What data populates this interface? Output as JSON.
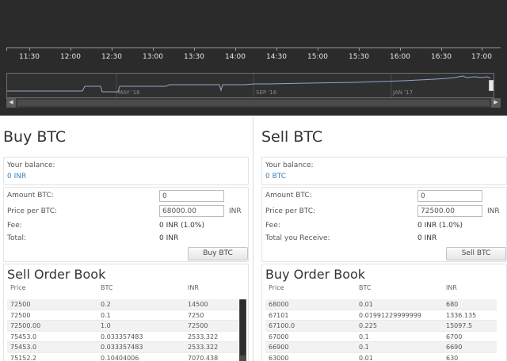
{
  "chart": {
    "time_labels": [
      "11:30",
      "12:00",
      "12:30",
      "13:00",
      "13:30",
      "14:00",
      "14:30",
      "15:00",
      "15:30",
      "16:00",
      "16:30",
      "17:00"
    ],
    "navigator_labels": [
      "MAY '16",
      "SEP '16",
      "JAN '17"
    ],
    "colors": {
      "background": "#2b2b2b",
      "line": "#8fa7c8"
    }
  },
  "buy": {
    "title": "Buy BTC",
    "balance_label": "Your balance:",
    "balance_value": "0 INR",
    "amount_label": "Amount BTC:",
    "amount_value": "0",
    "price_label": "Price per BTC:",
    "price_value": "68000.00",
    "price_unit": "INR",
    "fee_label": "Fee:",
    "fee_value": "0 INR (1.0%)",
    "total_label": "Total:",
    "total_value": "0 INR",
    "button_label": "Buy BTC",
    "book": {
      "title": "Sell Order Book",
      "columns": [
        "Price",
        "BTC",
        "INR"
      ],
      "rows": [
        [
          "72500",
          "0.2",
          "14500"
        ],
        [
          "72500",
          "0.1",
          "7250"
        ],
        [
          "72500.00",
          "1.0",
          "72500"
        ],
        [
          "75453.0",
          "0.033357483",
          "2533.322"
        ],
        [
          "75453.0",
          "0.033357483",
          "2533.322"
        ],
        [
          "75152.2",
          "0.10404006",
          "7070.438"
        ]
      ]
    }
  },
  "sell": {
    "title": "Sell BTC",
    "balance_label": "Your balance:",
    "balance_value": "0 BTC",
    "amount_label": "Amount BTC:",
    "amount_value": "0",
    "price_label": "Price per BTC:",
    "price_value": "72500.00",
    "price_unit": "INR",
    "fee_label": "Fee:",
    "fee_value": "0 INR (1.0%)",
    "total_label": "Total you Receive:",
    "total_value": "0 INR",
    "button_label": "Sell BTC",
    "book": {
      "title": "Buy Order Book",
      "columns": [
        "Price",
        "BTC",
        "INR"
      ],
      "rows": [
        [
          "68000",
          "0.01",
          "680"
        ],
        [
          "67101",
          "0.01991229999999",
          "1336.135"
        ],
        [
          "67100.0",
          "0.225",
          "15097.5"
        ],
        [
          "67000",
          "0.1",
          "6700"
        ],
        [
          "66900",
          "0.1",
          "6690"
        ],
        [
          "63000",
          "0.01",
          "630"
        ]
      ]
    }
  }
}
